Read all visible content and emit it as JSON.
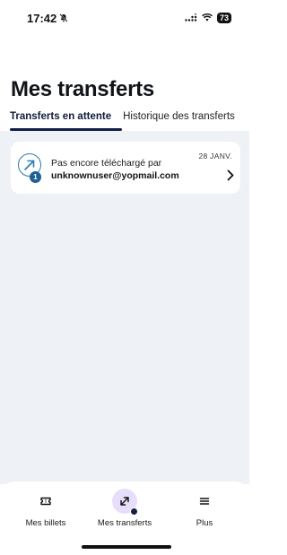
{
  "status_bar": {
    "time": "17:42",
    "battery": "73",
    "icons": [
      "bell-slash-icon",
      "signal-icon",
      "wifi-icon",
      "battery-icon"
    ]
  },
  "page": {
    "title": "Mes transferts"
  },
  "tabs": [
    {
      "label": "Transferts en attente",
      "active": true
    },
    {
      "label": "Historique des transferts",
      "active": false
    }
  ],
  "transfers": [
    {
      "icon": "transfer-out-arrow-icon",
      "badge": "1",
      "subtitle": "Pas encore téléchargé par",
      "user": "unknownuser@yopmail.com",
      "date": "28 JANV."
    }
  ],
  "bottom_nav": [
    {
      "label": "Mes billets",
      "icon": "ticket-icon",
      "active": false
    },
    {
      "label": "Mes transferts",
      "icon": "transfer-arrows-icon",
      "active": true
    },
    {
      "label": "Plus",
      "icon": "menu-icon",
      "active": false
    }
  ],
  "colors": {
    "accent": "#0f1f45",
    "icon_blue": "#2b7bb0",
    "badge_blue": "#1e5f95",
    "content_bg": "#eef1f5",
    "active_nav_bg": "#e6defb"
  }
}
